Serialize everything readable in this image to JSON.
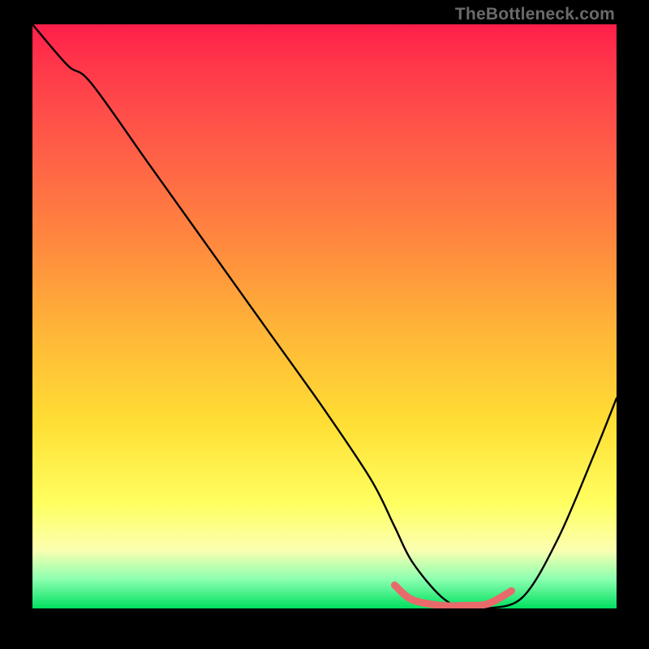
{
  "watermark": "TheBottleneck.com",
  "chart_data": {
    "type": "line",
    "title": "",
    "xlabel": "",
    "ylabel": "",
    "xlim": [
      0,
      100
    ],
    "ylim": [
      0,
      100
    ],
    "series": [
      {
        "name": "bottleneck-curve",
        "color": "#000000",
        "x": [
          0,
          6,
          10,
          20,
          30,
          40,
          50,
          58,
          62,
          65,
          70,
          74,
          78,
          84,
          90,
          96,
          100
        ],
        "y": [
          100,
          93,
          90,
          76,
          62,
          48,
          34,
          22,
          14,
          8,
          2,
          0,
          0,
          2,
          12,
          26,
          36
        ]
      },
      {
        "name": "optimal-range-highlight",
        "color": "#e86a6a",
        "x": [
          62,
          65,
          70,
          74,
          78,
          82
        ],
        "y": [
          4,
          1.5,
          0.5,
          0.5,
          0.8,
          3
        ]
      }
    ],
    "grid": false,
    "legend": false
  }
}
